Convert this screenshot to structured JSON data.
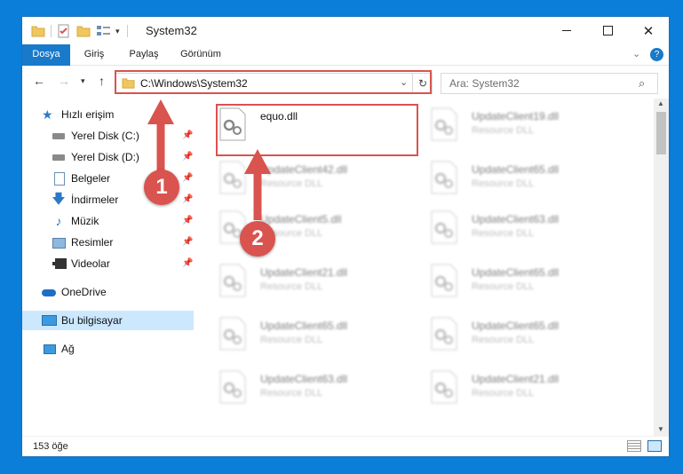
{
  "window": {
    "title": "System32"
  },
  "ribbon": {
    "tabs": [
      "Dosya",
      "Giriş",
      "Paylaş",
      "Görünüm"
    ]
  },
  "address": {
    "path": "C:\\Windows\\System32"
  },
  "search": {
    "placeholder": "Ara: System32"
  },
  "sidebar": {
    "items": [
      {
        "label": "Hızlı erişim",
        "icon": "star-icon"
      },
      {
        "label": "Yerel Disk (C:)",
        "icon": "drive-icon"
      },
      {
        "label": "Yerel Disk (D:)",
        "icon": "drive-icon"
      },
      {
        "label": "Belgeler",
        "icon": "documents-icon"
      },
      {
        "label": "İndirmeler",
        "icon": "download-icon"
      },
      {
        "label": "Müzik",
        "icon": "music-icon"
      },
      {
        "label": "Resimler",
        "icon": "pictures-icon"
      },
      {
        "label": "Videolar",
        "icon": "video-icon"
      },
      {
        "label": "OneDrive",
        "icon": "cloud-icon"
      },
      {
        "label": "Bu bilgisayar",
        "icon": "computer-icon"
      },
      {
        "label": "Ağ",
        "icon": "network-icon"
      }
    ]
  },
  "files": [
    {
      "name": "equo.dll",
      "type": ""
    },
    {
      "name": "UpdateClient19.dll",
      "type": "Resource DLL"
    },
    {
      "name": "UpdateClient42.dll",
      "type": "Resource DLL"
    },
    {
      "name": "UpdateClient65.dll",
      "type": "Resource DLL"
    },
    {
      "name": "UpdateClient5.dll",
      "type": "Resource DLL"
    },
    {
      "name": "UpdateClient63.dll",
      "type": "Resource DLL"
    },
    {
      "name": "UpdateClient21.dll",
      "type": "Resource DLL"
    },
    {
      "name": "UpdateClient65.dll",
      "type": "Resource DLL"
    },
    {
      "name": "UpdateClient65.dll",
      "type": "Resource DLL"
    },
    {
      "name": "UpdateClient65.dll",
      "type": "Resource DLL"
    },
    {
      "name": "UpdateClient63.dll",
      "type": "Resource DLL"
    },
    {
      "name": "UpdateClient21.dll",
      "type": "Resource DLL"
    }
  ],
  "status": {
    "count": "153 öğe"
  },
  "annotations": {
    "step1": "1",
    "step2": "2",
    "color": "#d9534f"
  }
}
